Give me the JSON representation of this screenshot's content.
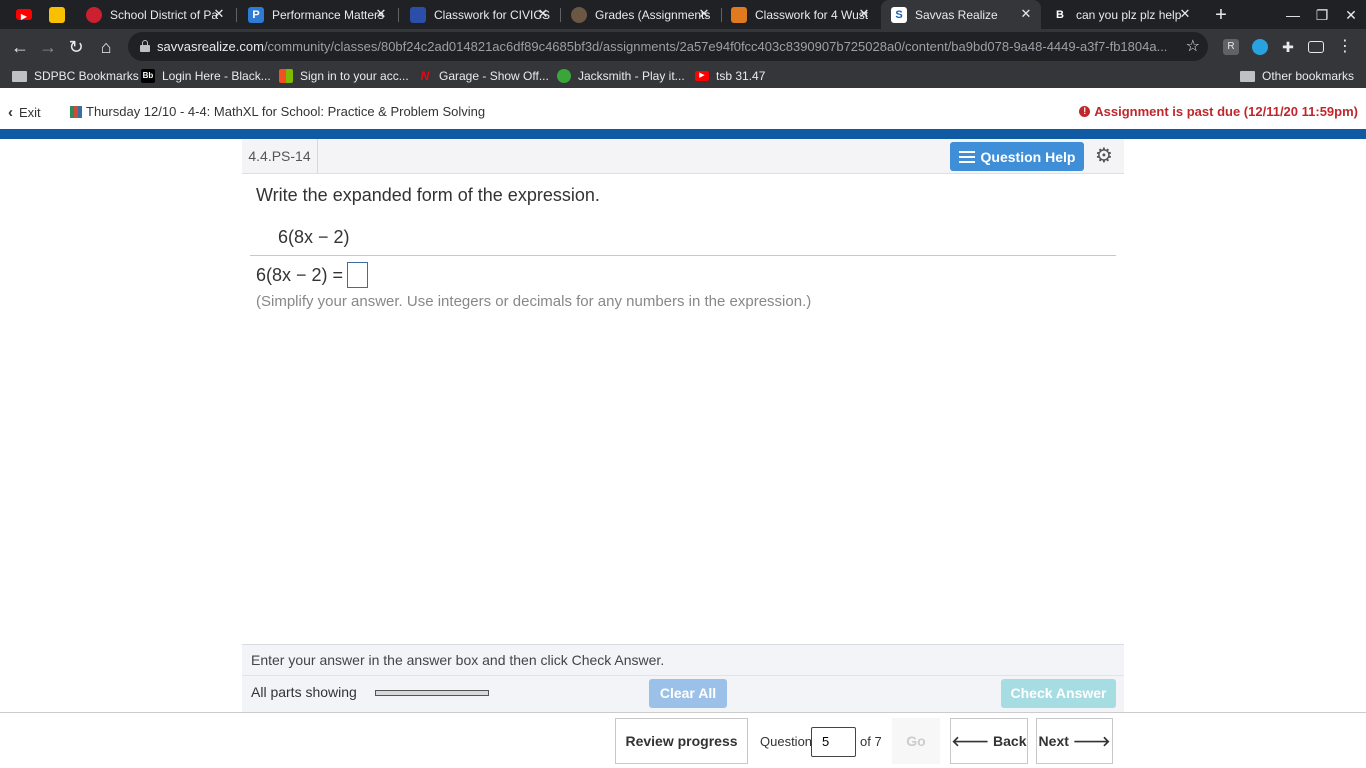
{
  "browser": {
    "tabs": [
      {
        "title": "",
        "favicon_color": "#ff0000",
        "favicon_glyph": "▶"
      },
      {
        "title": "",
        "favicon_color": "#f9c000",
        "favicon_glyph": "▤"
      },
      {
        "title": "School District of Pa",
        "favicon_color": "#cc1f2f",
        "favicon_glyph": "♦"
      },
      {
        "title": "Performance Matters",
        "favicon_color": "#2e7bd6",
        "favicon_glyph": "P"
      },
      {
        "title": "Classwork for CIVICS",
        "favicon_color": "#2b4fa8",
        "favicon_glyph": "▣"
      },
      {
        "title": "Grades (Assignments",
        "favicon_color": "#5a4a3a",
        "favicon_glyph": "☻"
      },
      {
        "title": "Classwork for 4 Wust",
        "favicon_color": "#e07a1f",
        "favicon_glyph": "▣"
      },
      {
        "title": "Savvas Realize",
        "favicon_color": "#ffffff",
        "favicon_glyph": "S"
      },
      {
        "title": "can you plz plz help",
        "favicon_color": "#202124",
        "favicon_glyph": "B"
      }
    ],
    "url_host": "savvasrealize.com",
    "url_path": "/community/classes/80bf24c2ad014821ac6df89c4685bf3d/assignments/2a57e94f0fcc403c8390907b725028a0/content/ba9bd078-9a48-4449-a3f7-fb1804a...",
    "bookmarks": [
      {
        "label": "SDPBC Bookmarks",
        "color": "#bdc1c6"
      },
      {
        "label": "Login Here - Black...",
        "color": "#000000",
        "glyph": "Bb"
      },
      {
        "label": "Sign in to your acc...",
        "color": "#f25022"
      },
      {
        "label": "Garage - Show Off...",
        "color": "#e50914",
        "glyph": "N"
      },
      {
        "label": "Jacksmith - Play it...",
        "color": "#3aa63a"
      },
      {
        "label": "tsb 31.47",
        "color": "#ff0000",
        "glyph": "▶"
      }
    ],
    "other_bookmarks": "Other bookmarks",
    "ext_r": "R"
  },
  "app": {
    "exit_label": "Exit",
    "assignment_title": "Thursday 12/10 - 4-4: MathXL for School: Practice & Problem Solving",
    "past_due": "Assignment is past due (12/11/20 11:59pm)",
    "past_due_color": "#c0272d"
  },
  "question": {
    "id": "4.4.PS-14",
    "help_label": "Question Help",
    "prompt": "Write the expanded form of the expression.",
    "expression": "6(8x − 2)",
    "answer_lhs": "6(8x − 2) =",
    "answer_value": "",
    "hint": "(Simplify your answer. Use integers or decimals for any numbers in the expression.)"
  },
  "footer": {
    "instruction": "Enter your answer in the answer box and then click Check Answer.",
    "parts_label": "All parts showing",
    "parts_progress": 1.0,
    "clear_label": "Clear All",
    "check_label": "Check Answer"
  },
  "nav": {
    "review_label": "Review progress",
    "question_label": "Question",
    "question_number": "5",
    "of_label": "of 7",
    "go_label": "Go",
    "back_label": "Back",
    "next_label": "Next"
  }
}
